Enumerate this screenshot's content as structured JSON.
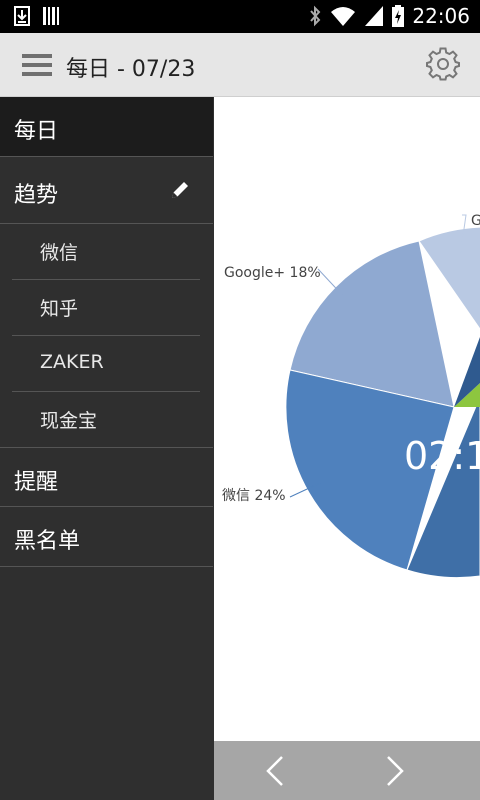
{
  "status_bar": {
    "time": "22:06",
    "left_icons": [
      "download-icon",
      "barcode-icon"
    ],
    "right_icons": [
      "bluetooth-icon",
      "wifi-icon",
      "signal-icon",
      "battery-charging-icon"
    ]
  },
  "action_bar": {
    "title": "每日 - 07/23",
    "menu_icon": "hamburger-menu-icon",
    "settings_icon": "gear-icon"
  },
  "drawer": {
    "items": [
      {
        "label": "每日",
        "selected": true
      },
      {
        "label": "趋势",
        "icon": "pencil-icon"
      },
      {
        "label": "微信",
        "sub": true
      },
      {
        "label": "知乎",
        "sub": true
      },
      {
        "label": "ZAKER",
        "sub": true
      },
      {
        "label": "现金宝",
        "sub": true
      },
      {
        "label": "提醒"
      },
      {
        "label": "黑名单"
      }
    ]
  },
  "chart_data": {
    "type": "pie",
    "slices": [
      {
        "label": "Google+ 18%",
        "value": 18,
        "color": "#8fa9d1"
      },
      {
        "label": "微信 24%",
        "value": 24,
        "color": "#4f81bd"
      },
      {
        "label": "G",
        "value": 8,
        "color": "#b9c9e3"
      }
    ],
    "center_label": "02:1",
    "visible_extra_colors": [
      "#3f6fa7",
      "#8dc63f",
      "#2f5a8f"
    ]
  },
  "bottom_nav": {
    "prev_icon": "chevron-left-icon",
    "next_icon": "chevron-right-icon"
  },
  "colors": {
    "status_bar": "#000000",
    "action_bar": "#e6e6e6",
    "drawer": "#2f2f2f",
    "drawer_selected": "#1c1c1c",
    "bottom_nav": "#a6a6a6"
  }
}
